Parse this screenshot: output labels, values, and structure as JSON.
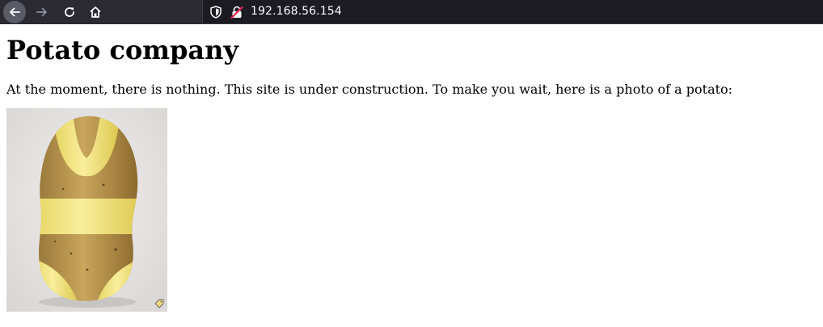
{
  "browser": {
    "url": "192.168.56.154",
    "icons": {
      "back": "arrow-left-icon",
      "forward": "arrow-right-icon",
      "reload": "reload-icon",
      "home": "home-icon",
      "tracking": "shield-icon",
      "security": "insecure-lock-icon"
    }
  },
  "page": {
    "heading": "Potato company",
    "message": "At the moment, there is nothing. This site is under construction. To make you wait, here is a photo of a potato:",
    "photo_subject": "potato"
  },
  "colors": {
    "toolbar_bg": "#2b2a33",
    "urlbar_bg": "#1c1b22",
    "page_bg": "#ffffff",
    "insecure_accent": "#e22850"
  }
}
